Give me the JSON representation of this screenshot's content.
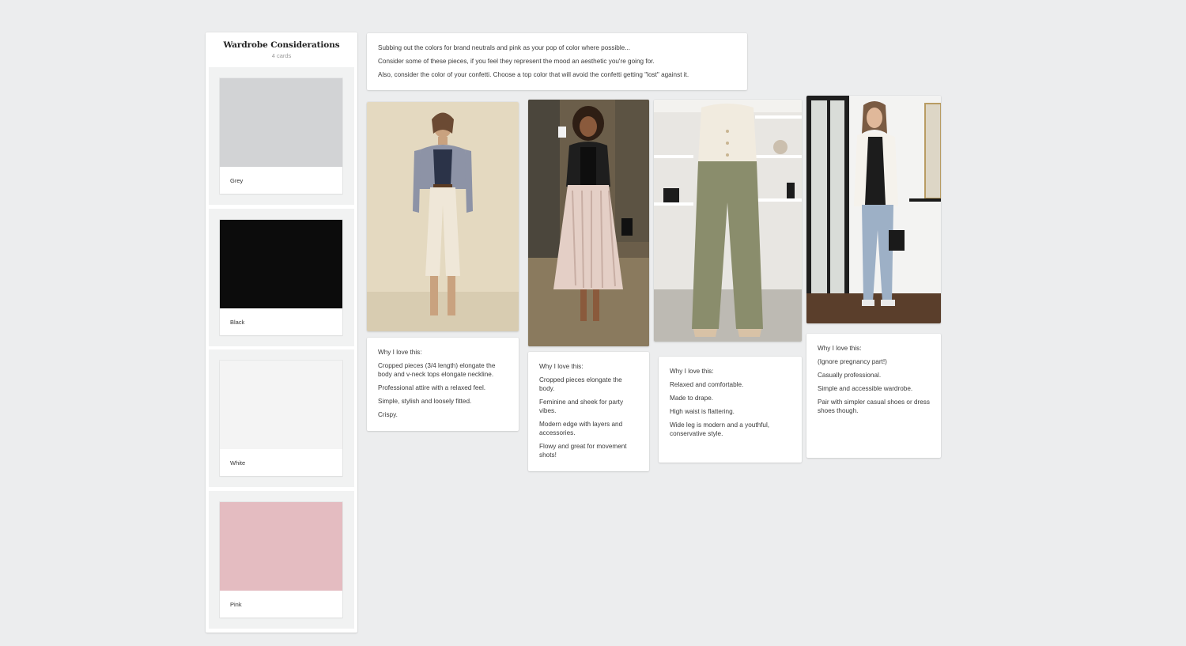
{
  "column": {
    "title": "Wardrobe Considerations",
    "count": "4 cards",
    "swatches": [
      {
        "label": "Grey",
        "color": "#d2d3d5"
      },
      {
        "label": "Black",
        "color": "#0c0c0c"
      },
      {
        "label": "White",
        "color": "#f4f4f4"
      },
      {
        "label": "Pink",
        "color": "#e4bcc1"
      }
    ]
  },
  "intro_note": {
    "lines": [
      "Subbing out the colors for brand neutrals and pink as your pop of color where possible...",
      "Consider some of these pieces, if you feel they represent the mood an aesthetic you're going for.",
      "Also, consider the color of your confetti. Choose a top color that will avoid the confetti getting \"lost\" against it."
    ]
  },
  "outfits": [
    {
      "photo_alt": "Woman in grey blazer, navy top and cream cropped trousers",
      "notes": [
        "Why I love this:",
        "Cropped pieces (3/4 length) elongate the body and v-neck tops elongate neckline.",
        "Professional attire with a relaxed feel.",
        "Simple, stylish and loosely fitted.",
        "Crispy."
      ]
    },
    {
      "photo_alt": "Woman in black leather jacket and pleated blush skirt",
      "notes": [
        "Why I love this:",
        "Cropped pieces elongate the body.",
        "Feminine and sheek for party vibes.",
        "Modern edge with layers and accessories.",
        "Flowy and great for movement shots!"
      ]
    },
    {
      "photo_alt": "Woman in cream cardigan and olive wide-leg trousers",
      "notes": [
        "Why I love this:",
        "Relaxed and comfortable.",
        "Made to drape.",
        "High waist is flattering.",
        "Wide leg is modern and a youthful, conservative style."
      ]
    },
    {
      "photo_alt": "Woman in white blazer, black top and jeans with sneakers",
      "notes": [
        "Why I love this:",
        "(Ignore pregnancy part!)",
        "Casually professional.",
        "Simple and accessible wardrobe.",
        "Pair with simpler casual shoes or dress shoes though."
      ]
    }
  ]
}
